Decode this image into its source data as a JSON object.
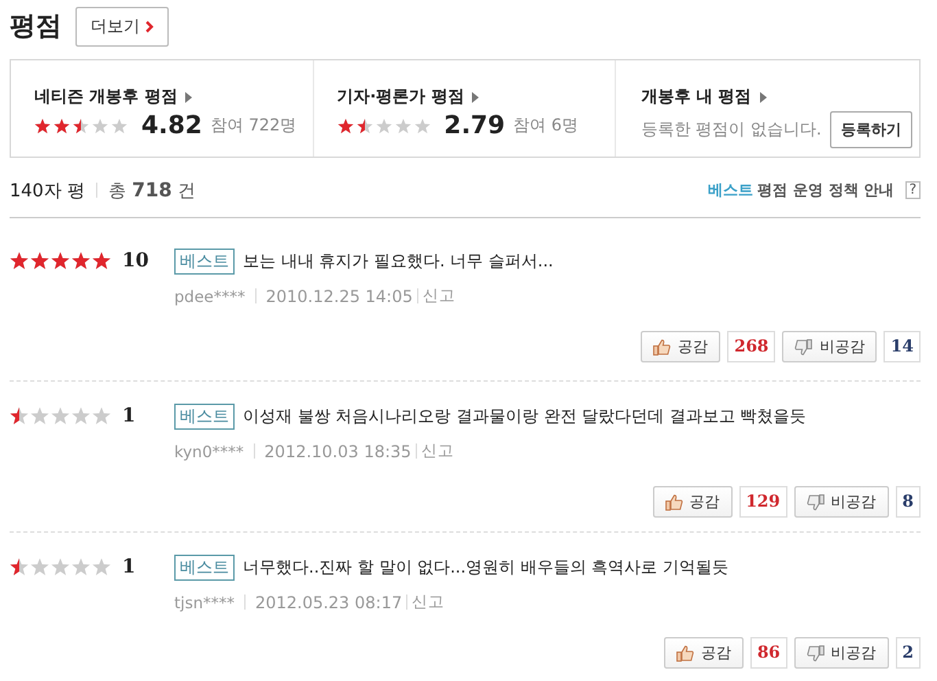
{
  "heading": "평점",
  "more_button": "더보기",
  "summary": [
    {
      "title": "네티즌 개봉후 평점",
      "stars": 2.5,
      "score": "4.82",
      "participants": "참여 722명"
    },
    {
      "title": "기자·평론가 평점",
      "stars": 1.5,
      "score": "2.79",
      "participants": "참여 6명"
    },
    {
      "title": "개봉후 내 평점",
      "message": "등록한 평점이 없습니다.",
      "button": "등록하기"
    }
  ],
  "list_header": {
    "title": "140자 평",
    "total_label": "총",
    "total": "718",
    "total_unit": "건",
    "best_label": "베스트",
    "policy": "평점 운영 정책 안내",
    "help": "?"
  },
  "reviews": [
    {
      "stars": 5,
      "score": "10",
      "badge": "베스트",
      "text": "보는 내내 휴지가 필요했다. 너무 슬퍼서...",
      "user": "pdee****",
      "date": "2010.12.25 14:05",
      "report": "신고",
      "like_label": "공감",
      "likes": "268",
      "dislike_label": "비공감",
      "dislikes": "14"
    },
    {
      "stars": 0.5,
      "score": "1",
      "badge": "베스트",
      "text": "이성재 불쌍 처음시나리오랑 결과물이랑 완전 달랐다던데 결과보고 빡쳤을듯",
      "user": "kyn0****",
      "date": "2012.10.03 18:35",
      "report": "신고",
      "like_label": "공감",
      "likes": "129",
      "dislike_label": "비공감",
      "dislikes": "8"
    },
    {
      "stars": 0.5,
      "score": "1",
      "badge": "베스트",
      "text": "너무했다..진짜 할 말이 없다...영원히 배우들의 흑역사로 기억될듯",
      "user": "tjsn****",
      "date": "2012.05.23 08:17",
      "report": "신고",
      "like_label": "공감",
      "likes": "86",
      "dislike_label": "비공감",
      "dislikes": "2"
    }
  ]
}
